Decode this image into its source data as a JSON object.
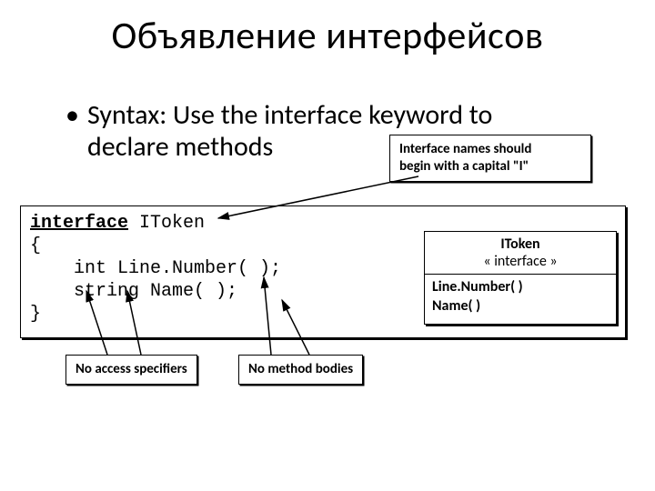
{
  "title": "Объявление интерфейсов",
  "bullet": {
    "line1": "Syntax: Use the interface keyword to",
    "line2": "declare methods"
  },
  "notes": {
    "names_l1": "Interface names should",
    "names_l2": "begin with a capital \"I\"",
    "access": "No access specifiers",
    "bodies": "No method  bodies"
  },
  "code": {
    "kw": "interface",
    "after_kw": " IToken",
    "brace_open": "{",
    "line1": "    int Line.Number( );",
    "line2": "    string Name( );",
    "brace_close": "}"
  },
  "uml": {
    "name": "IToken",
    "stereo": "« interface »",
    "op1": "Line.Number( )",
    "op2": "Name( )"
  }
}
